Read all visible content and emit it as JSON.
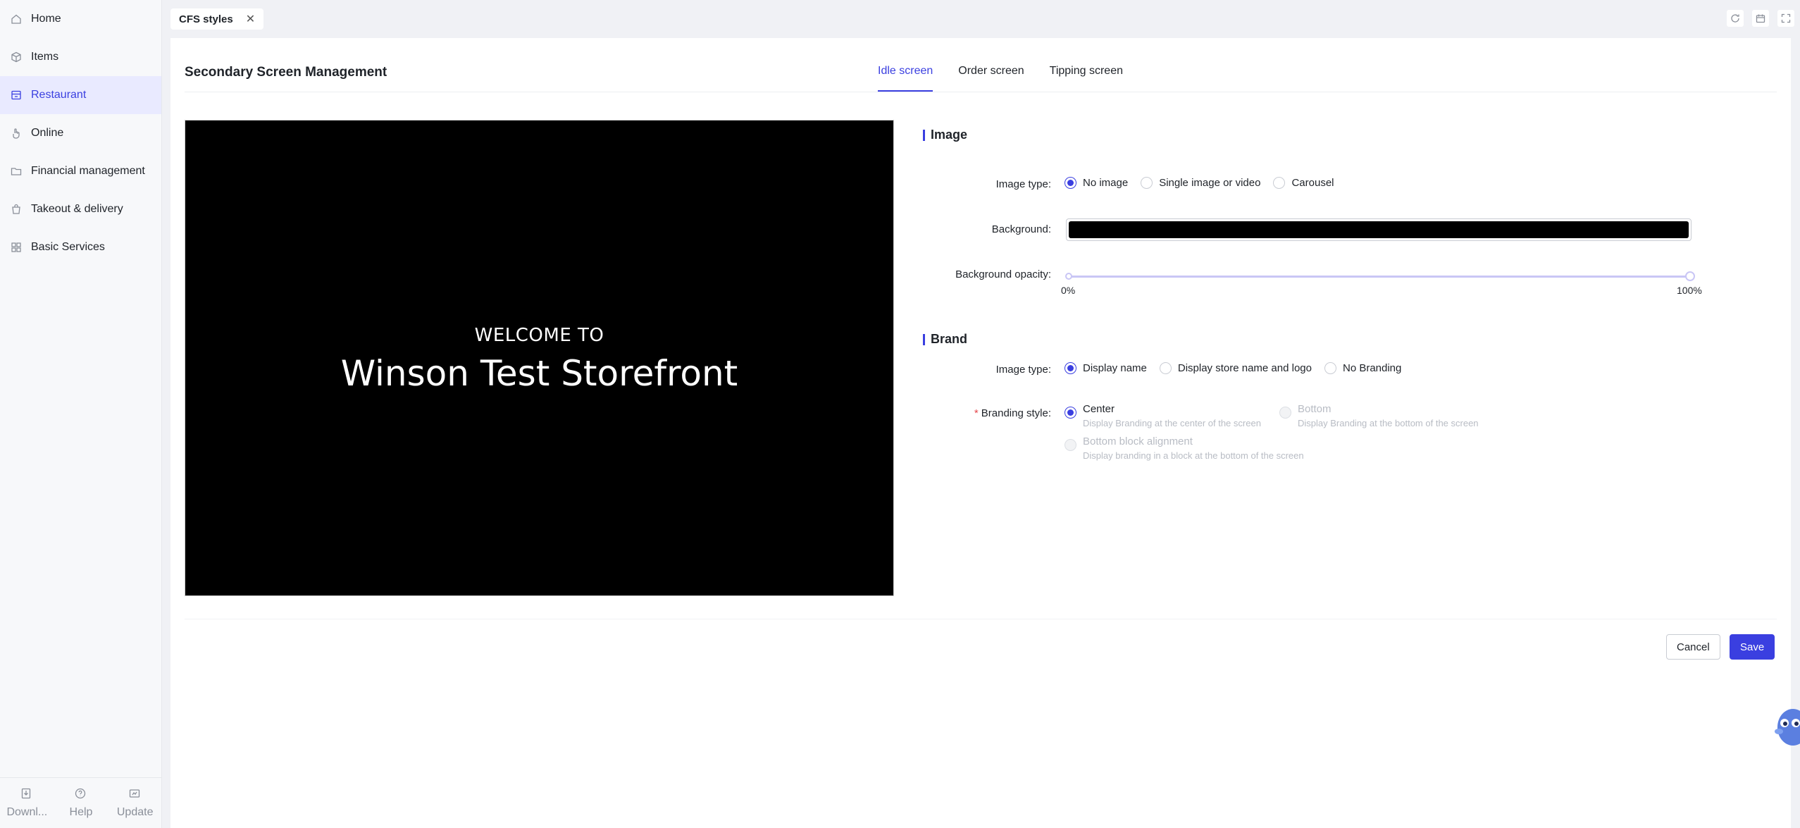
{
  "sidebar": {
    "items": [
      {
        "label": "Home",
        "icon": "home-icon"
      },
      {
        "label": "Items",
        "icon": "box-icon"
      },
      {
        "label": "Restaurant",
        "icon": "store-icon",
        "active": true
      },
      {
        "label": "Online",
        "icon": "hand-icon"
      },
      {
        "label": "Financial management",
        "icon": "folder-icon"
      },
      {
        "label": "Takeout & delivery",
        "icon": "bag-icon"
      },
      {
        "label": "Basic Services",
        "icon": "grid-icon"
      }
    ],
    "bottom": [
      {
        "label": "Downl...",
        "icon": "download-icon"
      },
      {
        "label": "Help",
        "icon": "help-icon"
      },
      {
        "label": "Update",
        "icon": "update-icon"
      }
    ]
  },
  "tabbar": {
    "open_tab": "CFS styles",
    "close_glyph": "✕"
  },
  "page": {
    "title": "Secondary Screen Management",
    "tabs": [
      "Idle screen",
      "Order screen",
      "Tipping screen"
    ],
    "active_tab": "Idle screen"
  },
  "preview": {
    "welcome": "WELCOME TO",
    "store_name": "Winson Test Storefront",
    "background_color": "#000000"
  },
  "image_section": {
    "title": "Image",
    "type_label": "Image type",
    "type_options": [
      "No image",
      "Single image or video",
      "Carousel"
    ],
    "type_selected": "No image",
    "background_label": "Background",
    "background_color": "#000000",
    "opacity_label": "Background opacity",
    "opacity_min_label": "0%",
    "opacity_max_label": "100%",
    "opacity_value": 1.0
  },
  "brand_section": {
    "title": "Brand",
    "type_label": "Image type",
    "type_options": [
      "Display name",
      "Display store name and logo",
      "No Branding"
    ],
    "type_selected": "Display name",
    "style_label": "Branding style",
    "style_options": [
      {
        "title": "Center",
        "desc": "Display Branding at the center of the screen"
      },
      {
        "title": "Bottom",
        "desc": "Display Branding at the bottom of the screen"
      },
      {
        "title": "Bottom block alignment",
        "desc": "Display branding in a block at the bottom of the screen"
      }
    ],
    "style_selected": "Center"
  },
  "footer": {
    "cancel": "Cancel",
    "save": "Save"
  },
  "colors": {
    "accent": "#3a3fe0",
    "required": "#e5484d"
  }
}
